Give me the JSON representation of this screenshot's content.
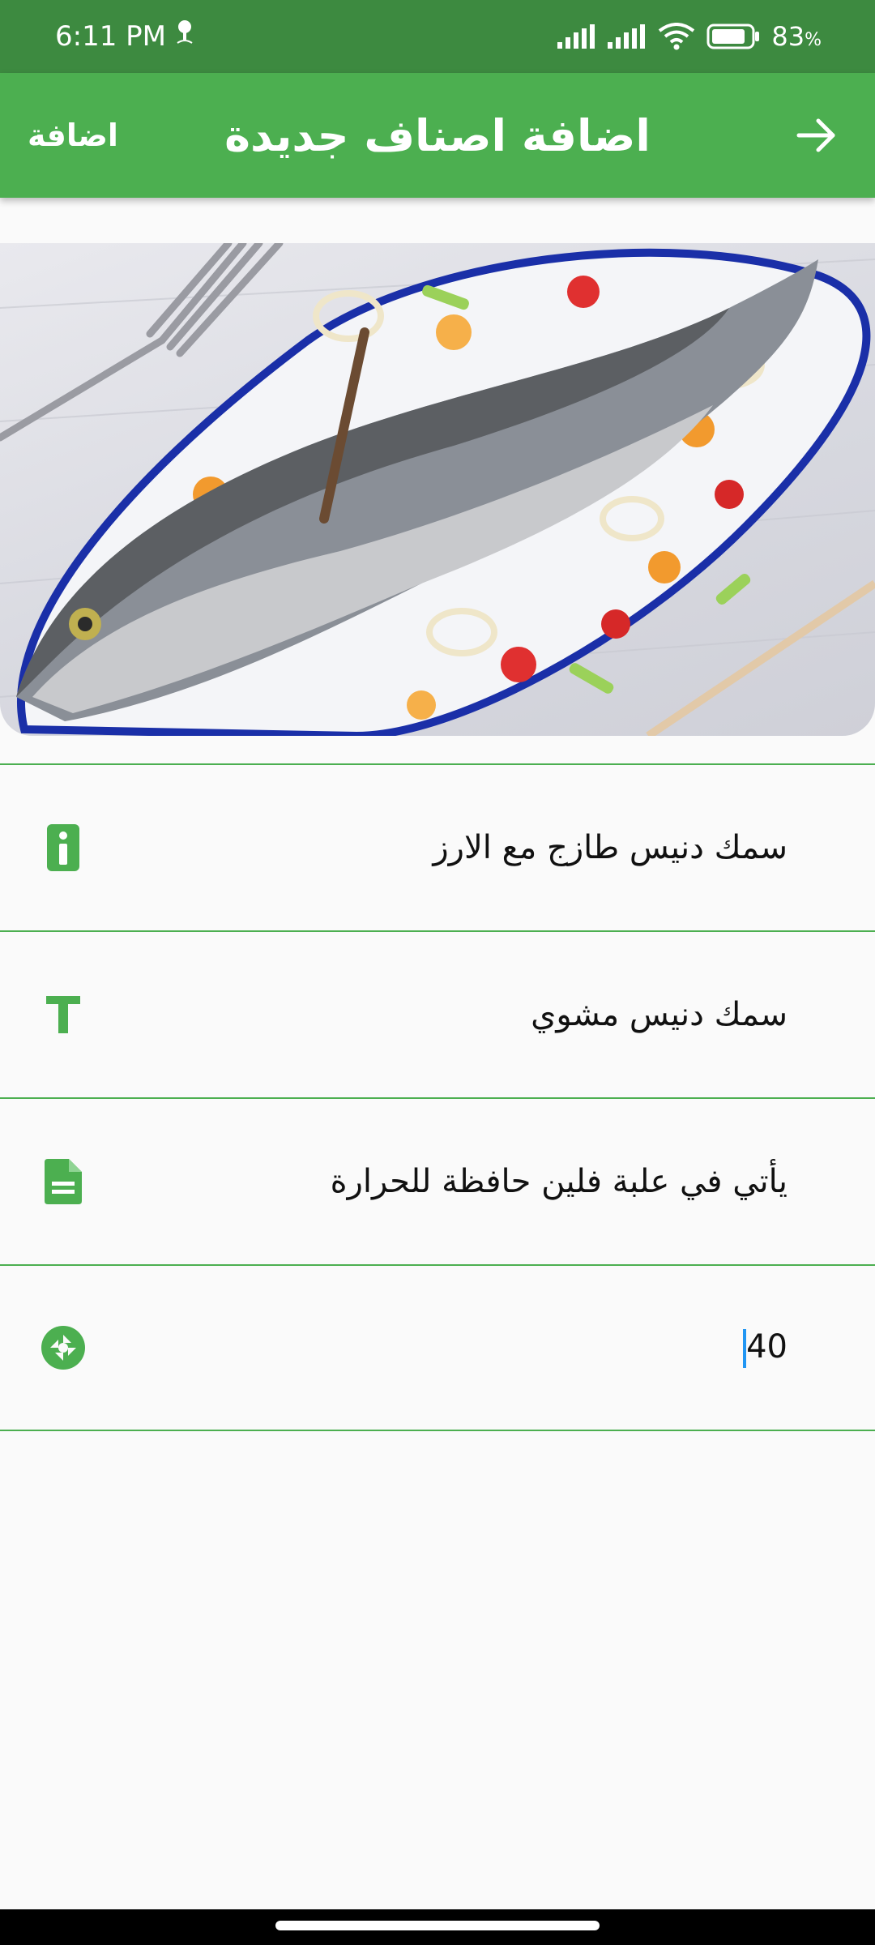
{
  "status_bar": {
    "time": "6:11 PM",
    "battery_percent": "83",
    "battery_unit": "%",
    "icons": [
      "notification-icon",
      "signal-icon",
      "signal-icon",
      "wifi-icon",
      "battery-icon"
    ]
  },
  "app_bar": {
    "title": "اضافة اصناف جديدة",
    "add_label": "اضافة",
    "back_icon": "arrow-forward-icon"
  },
  "colors": {
    "primary": "#4caf50",
    "status_bar": "#3d8a40",
    "cursor": "#2196f3"
  },
  "form": {
    "rows": [
      {
        "icon": "info-icon",
        "value": "سمك دنيس طازج مع الارز"
      },
      {
        "icon": "text-icon",
        "value": "سمك دنيس مشوي"
      },
      {
        "icon": "document-icon",
        "value": "يأتي في علبة فلين حافظة للحرارة"
      },
      {
        "icon": "aperture-icon",
        "value": "40"
      }
    ]
  }
}
